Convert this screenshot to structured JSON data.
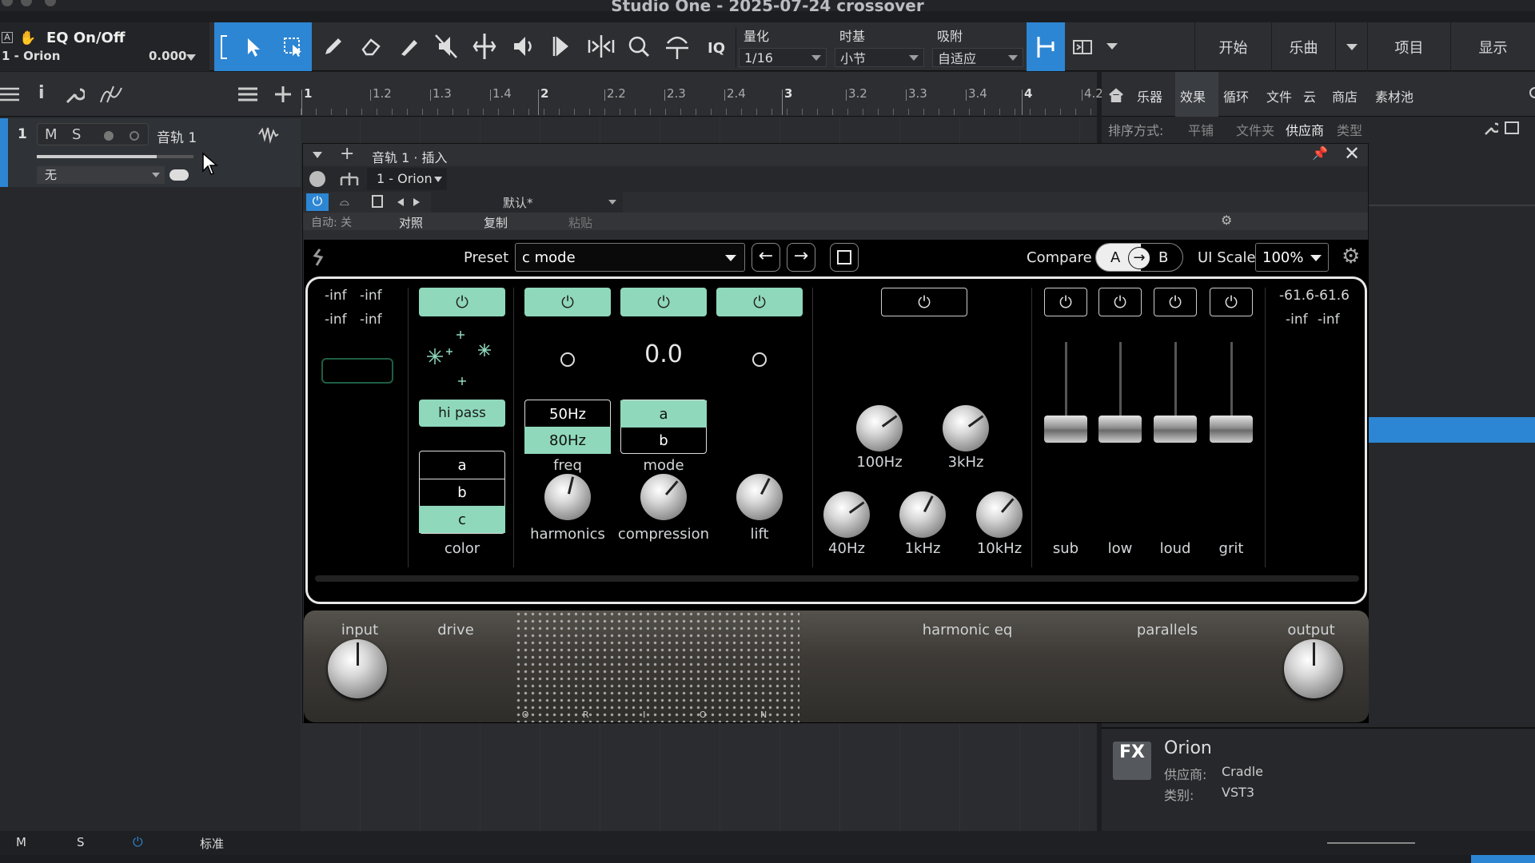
{
  "window": {
    "title": "Studio One - 2025-07-24 crossover"
  },
  "toolbar": {
    "track_name": "EQ On/Off",
    "track_sub": "1 - Orion",
    "value": "0.000",
    "iq": "IQ",
    "quantize_label": "量化",
    "quantize_value": "1/16",
    "timebase_label": "时基",
    "timebase_value": "小节",
    "snap_label": "吸附",
    "snap_value": "自适应",
    "nav": [
      "开始",
      "乐曲",
      "项目",
      "显示"
    ]
  },
  "ruler": {
    "ticks": [
      "1",
      "1.2",
      "1.3",
      "1.4",
      "2",
      "2.2",
      "2.3",
      "2.4",
      "3",
      "3.2",
      "3.3",
      "3.4",
      "4",
      "4.2"
    ]
  },
  "track": {
    "number": "1",
    "mute": "M",
    "solo": "S",
    "name": "音轨 1",
    "input": "无"
  },
  "browser": {
    "tabs": [
      "乐器",
      "效果",
      "循环",
      "文件",
      "云",
      "商店",
      "素材池"
    ],
    "active_tab": "效果",
    "sort_label": "排序方式:",
    "sort_options": [
      "平铺",
      "文件夹",
      "供应商",
      "类型"
    ],
    "active_sort": "供应商",
    "info": {
      "badge": "FX",
      "name": "Orion",
      "vendor_label": "供应商:",
      "vendor": "Cradle",
      "category_label": "类别:",
      "category": "VST3"
    }
  },
  "insert_window": {
    "title": "音轨 1 · 插入",
    "slot": "1 - Orion",
    "preset": "默认*",
    "auto_label": "自动: 关",
    "compare": "对照",
    "copy": "复制",
    "paste": "粘贴"
  },
  "plugin": {
    "preset_label": "Preset",
    "preset_value": "c mode",
    "compare_label": "Compare",
    "compare_a": "A",
    "compare_b": "B",
    "ui_scale_label": "UI Scale",
    "ui_scale_value": "100%",
    "input_meter": [
      "-inf",
      "-inf",
      "-inf",
      "-inf"
    ],
    "output_meter": [
      "-61.6",
      "-61.6",
      "-inf",
      "-inf"
    ],
    "drive": {
      "filter_label": "hi pass",
      "color_options": [
        "a",
        "b",
        "c"
      ],
      "color_selected": "c",
      "color_label": "color"
    },
    "freq": {
      "options": [
        "50Hz",
        "80Hz"
      ],
      "label": "freq"
    },
    "mode": {
      "value": "0.0",
      "options": [
        "a",
        "b"
      ],
      "label": "mode"
    },
    "knobs_drive": [
      {
        "label": "harmonics",
        "value": 0.55
      },
      {
        "label": "compression",
        "value": 0.65
      },
      {
        "label": "lift",
        "value": 0.6
      }
    ],
    "eq_bands_top": [
      {
        "label": "100Hz",
        "value": 0.7
      },
      {
        "label": "3kHz",
        "value": 0.7
      }
    ],
    "eq_bands_bottom": [
      {
        "label": "40Hz",
        "value": 0.7
      },
      {
        "label": "1kHz",
        "value": 0.6
      },
      {
        "label": "10kHz",
        "value": 0.65
      }
    ],
    "parallels": [
      {
        "label": "sub",
        "value": 0
      },
      {
        "label": "low",
        "value": 0
      },
      {
        "label": "loud",
        "value": 0
      },
      {
        "label": "grit",
        "value": 0
      }
    ],
    "sections": {
      "input": "input",
      "drive": "drive",
      "harmonic_eq": "harmonic eq",
      "parallels": "parallels",
      "output": "output"
    },
    "brand": "O R I O N"
  },
  "statusbar": {
    "m": "M",
    "s": "S",
    "mode": "标准"
  },
  "colors": {
    "accent": "#8fd8bb",
    "blue": "#2d86d3"
  }
}
